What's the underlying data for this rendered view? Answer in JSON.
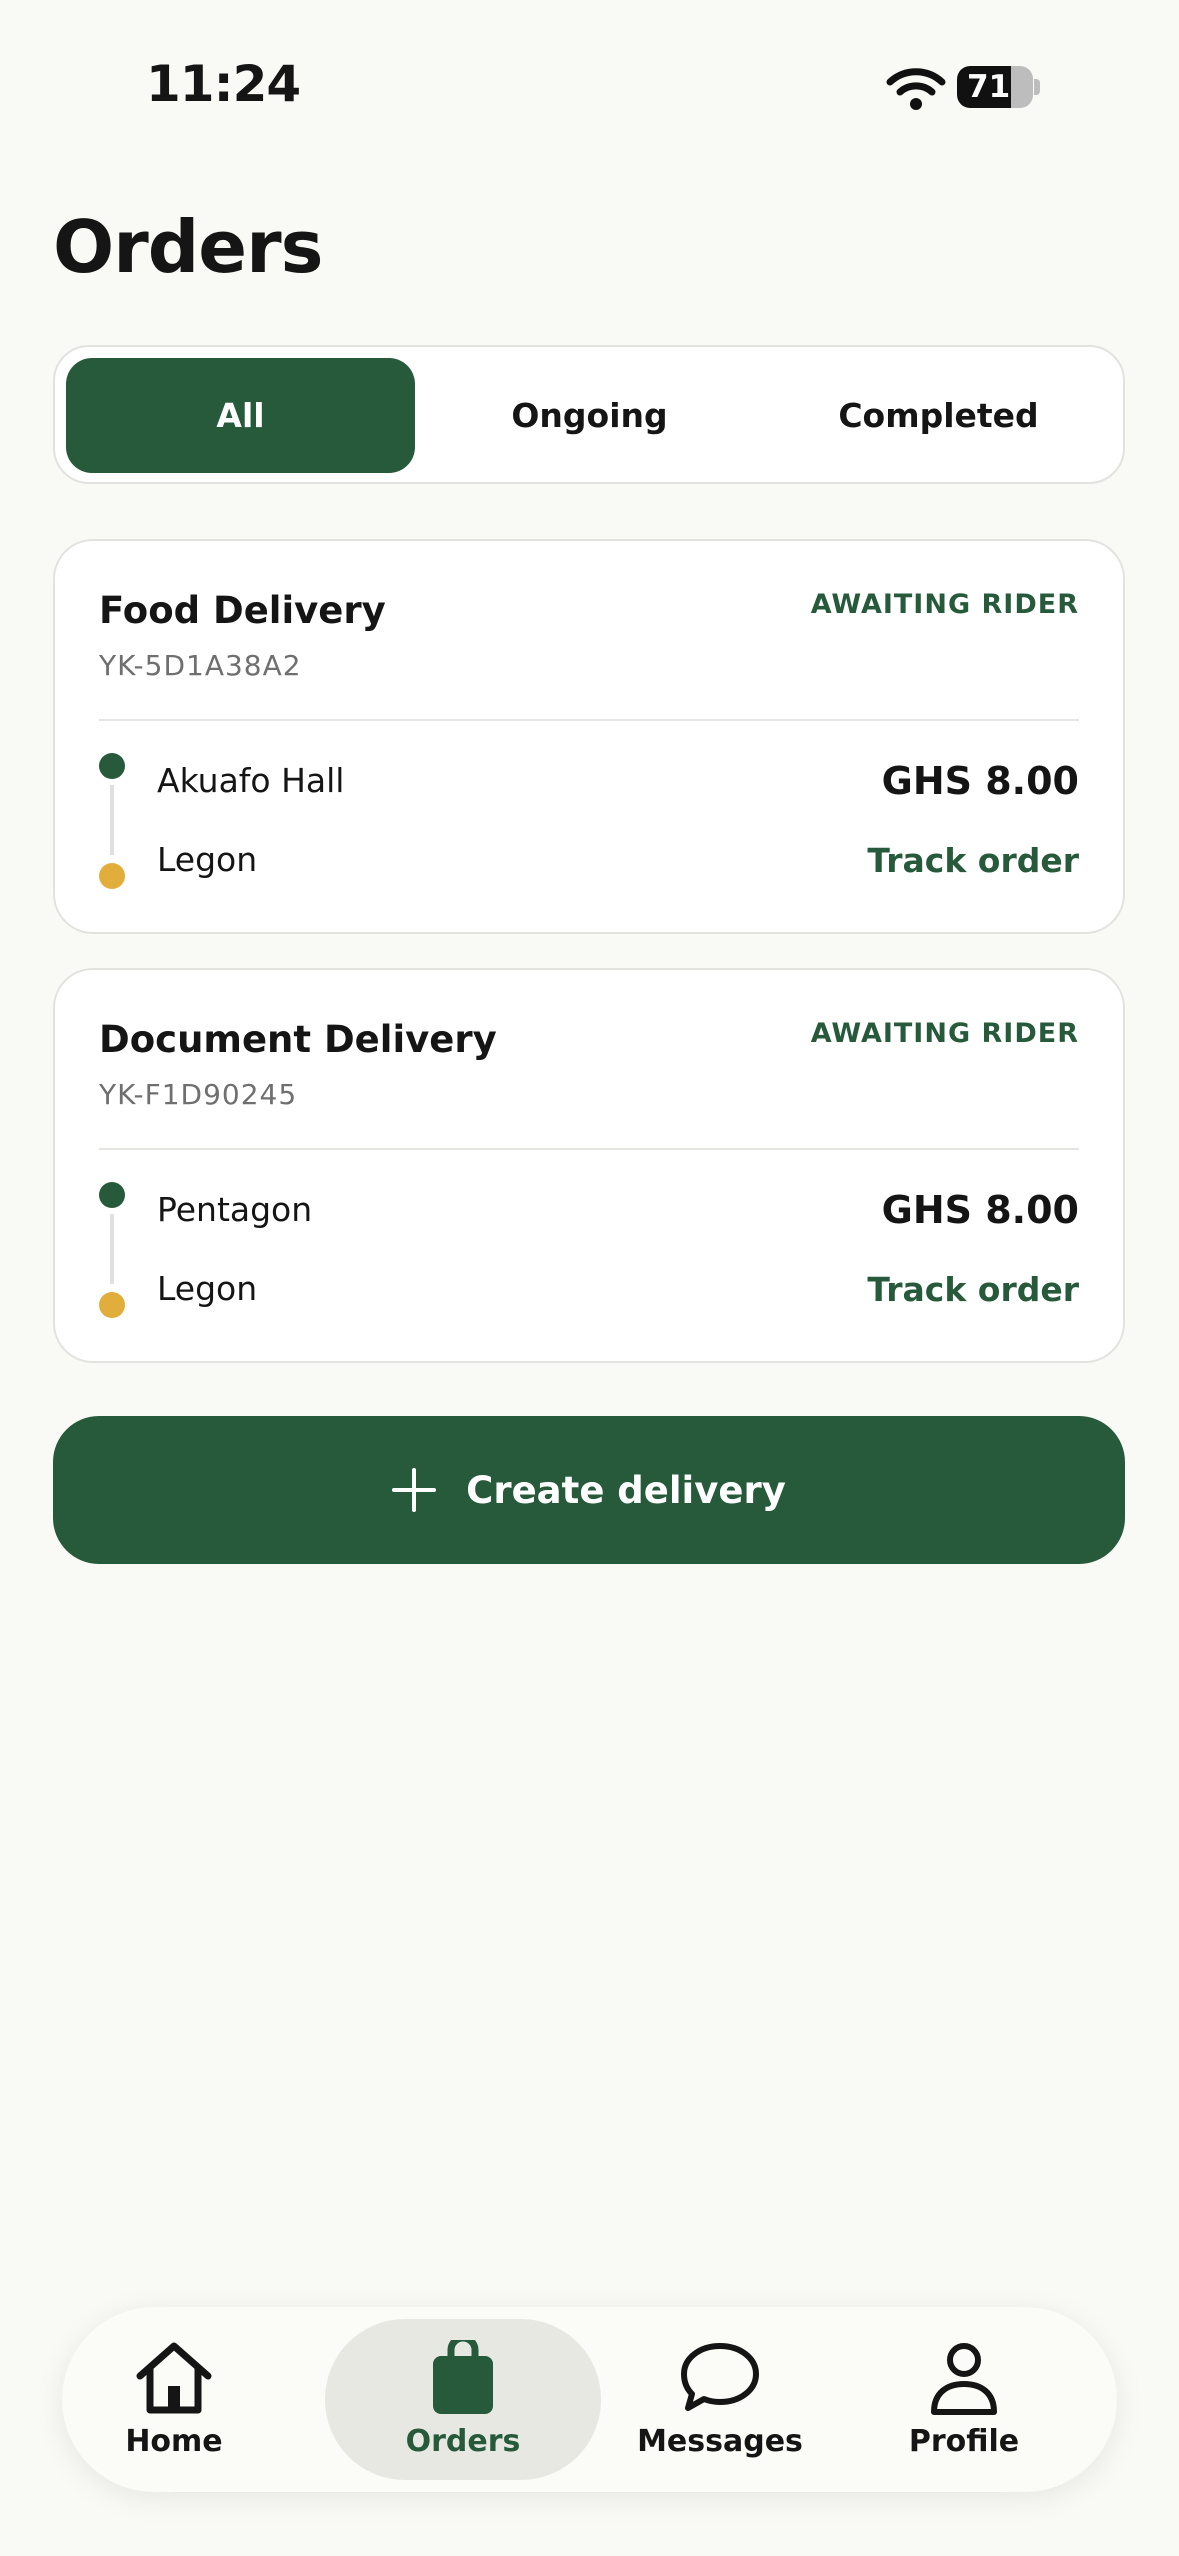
{
  "status_bar": {
    "time": "11:24",
    "battery": "71",
    "battery_level": 0.71
  },
  "page": {
    "title": "Orders"
  },
  "filters": {
    "all": "All",
    "ongoing": "Ongoing",
    "completed": "Completed",
    "selected": "All"
  },
  "orders": [
    {
      "title": "Food Delivery",
      "code": "YK-5D1A38A2",
      "status": "AWAITING RIDER",
      "from": "Akuafo Hall",
      "to": "Legon",
      "price": "GHS 8.00",
      "action": "Track order"
    },
    {
      "title": "Document Delivery",
      "code": "YK-F1D90245",
      "status": "AWAITING RIDER",
      "from": "Pentagon",
      "to": "Legon",
      "price": "GHS 8.00",
      "action": "Track order"
    }
  ],
  "create_button": {
    "label": "Create delivery"
  },
  "tabbar": {
    "home": "Home",
    "orders": "Orders",
    "messages": "Messages",
    "profile": "Profile",
    "active": "Orders"
  },
  "colors": {
    "accent": "#265a3b",
    "destination_dot": "#e2ae3b",
    "background": "#f9f9f5"
  }
}
